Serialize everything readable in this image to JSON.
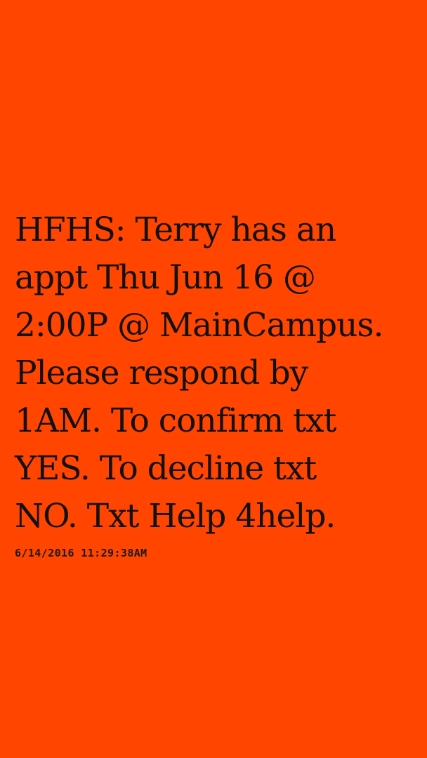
{
  "background_color": "#ff4500",
  "text_color": "#111111",
  "message": {
    "text": "HFHS: Terry has an\nappt Thu Jun 16 @\n2:00P @ MainCampus.\nPlease respond by\n1AM. To confirm txt\nYES. To decline txt\nNO. Txt Help 4help.",
    "timestamp": "6/14/2016 11:29:38AM"
  }
}
